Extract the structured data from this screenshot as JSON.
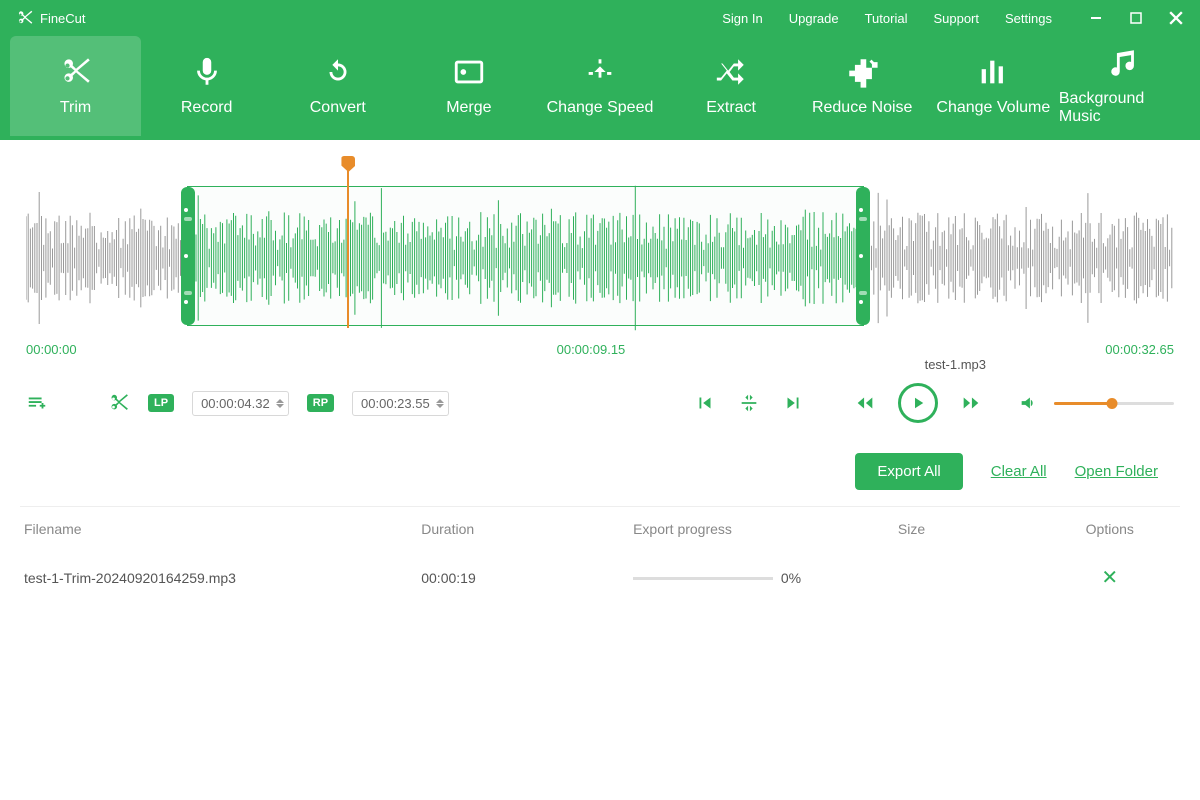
{
  "app": {
    "name": "FineCut"
  },
  "topnav": {
    "signin": "Sign In",
    "upgrade": "Upgrade",
    "tutorial": "Tutorial",
    "support": "Support",
    "settings": "Settings"
  },
  "tools": {
    "trim": "Trim",
    "record": "Record",
    "convert": "Convert",
    "merge": "Merge",
    "changespeed": "Change Speed",
    "extract": "Extract",
    "reducenoise": "Reduce Noise",
    "changevolume": "Change Volume",
    "bgmusic": "Background Music"
  },
  "timeline": {
    "start": "00:00:00",
    "mid": "00:00:09.15",
    "end": "00:00:32.65",
    "lp_label": "LP",
    "lp_value": "00:00:04.32",
    "rp_label": "RP",
    "rp_value": "00:00:23.55",
    "now_playing": "test-1.mp3"
  },
  "export": {
    "all": "Export All",
    "clear": "Clear All",
    "open": "Open Folder"
  },
  "table": {
    "headers": {
      "filename": "Filename",
      "duration": "Duration",
      "progress": "Export progress",
      "size": "Size",
      "options": "Options"
    },
    "rows": [
      {
        "filename": "test-1-Trim-20240920164259.mp3",
        "duration": "00:00:19",
        "progress_pct": "0%",
        "size": ""
      }
    ]
  }
}
